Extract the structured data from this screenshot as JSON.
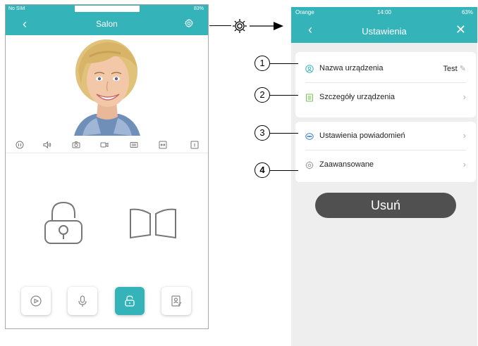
{
  "left": {
    "status": {
      "carrier": "No SIM",
      "battery": "83%"
    },
    "nav": {
      "title": "Salon",
      "back_icon": "chevron-left-icon",
      "settings_icon": "gear-icon"
    },
    "toolbar_icons": [
      "pause-icon",
      "speaker-icon",
      "camera-icon",
      "video-record-icon",
      "film-icon",
      "resize-icon",
      "info-icon"
    ],
    "main_icons": [
      "unlock-icon",
      "gate-icon"
    ],
    "bottom_buttons": [
      {
        "icon": "eye-icon",
        "active": false
      },
      {
        "icon": "microphone-icon",
        "active": false
      },
      {
        "icon": "lock-open-icon",
        "active": true
      },
      {
        "icon": "contact-edit-icon",
        "active": false
      }
    ]
  },
  "right": {
    "status": {
      "carrier": "Orange",
      "time": "14:00",
      "battery": "63%"
    },
    "nav": {
      "title": "Ustawienia"
    },
    "items": [
      {
        "label": "Nazwa urządzenia",
        "value": "Test",
        "icon": "person-icon"
      },
      {
        "label": "Szczegóły urządzenia",
        "icon": "document-icon"
      },
      {
        "label": "Ustawienia powiadomień",
        "icon": "chat-bubble-icon"
      },
      {
        "label": "Zaawansowane",
        "icon": "gear-icon"
      }
    ],
    "delete_label": "Usuń"
  },
  "callouts": [
    "1",
    "2",
    "3",
    "4"
  ],
  "colors": {
    "accent": "#34b3b9",
    "delete_button": "#505050",
    "settings_bg": "#eeeeee"
  }
}
